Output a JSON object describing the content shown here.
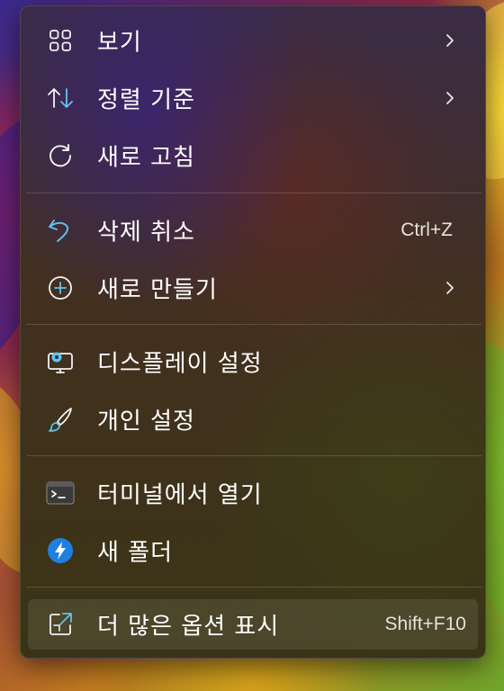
{
  "menu": {
    "items": [
      {
        "label": "보기",
        "icon": "grid-icon",
        "has_submenu": true
      },
      {
        "label": "정렬 기준",
        "icon": "sort-arrows-icon",
        "has_submenu": true
      },
      {
        "label": "새로 고침",
        "icon": "refresh-icon",
        "has_submenu": false
      },
      {
        "label": "삭제 취소",
        "icon": "undo-icon",
        "shortcut": "Ctrl+Z"
      },
      {
        "label": "새로 만들기",
        "icon": "plus-circle-icon",
        "has_submenu": true
      },
      {
        "label": "디스플레이 설정",
        "icon": "display-settings-icon"
      },
      {
        "label": "개인 설정",
        "icon": "brush-icon"
      },
      {
        "label": "터미널에서 열기",
        "icon": "terminal-icon"
      },
      {
        "label": "새 폴더",
        "icon": "lightning-app-icon"
      },
      {
        "label": "더 많은 옵션 표시",
        "icon": "expand-icon",
        "shortcut": "Shift+F10",
        "highlighted": true
      }
    ]
  },
  "colors": {
    "icon_accent": "#5fc3f0",
    "icon_white": "#f2f2f2",
    "app_blue": "#1f7fe0"
  }
}
